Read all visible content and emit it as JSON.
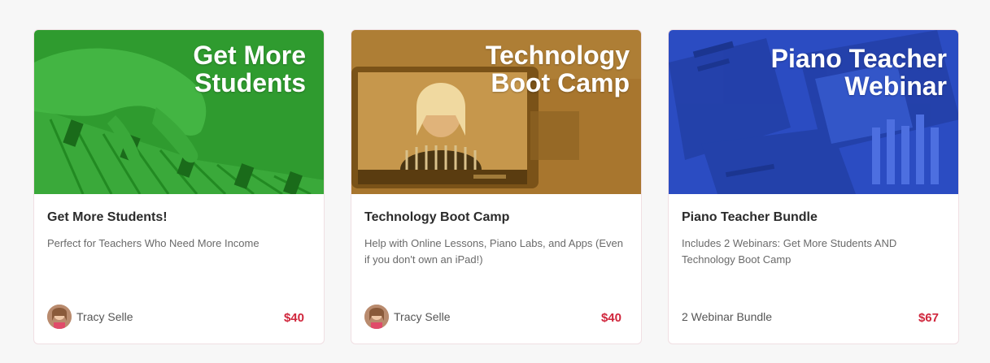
{
  "colors": {
    "green_banner": "#2f9b2f",
    "gold_banner": "#a8762e",
    "blue_banner": "#2b4cc2",
    "price": "#d0263c"
  },
  "cards": [
    {
      "banner_text": "Get More\nStudents",
      "title": "Get More Students!",
      "description": "Perfect for Teachers Who Need More Income",
      "author": "Tracy Selle",
      "price": "$40"
    },
    {
      "banner_text": "Technology\nBoot Camp",
      "title": "Technology Boot Camp",
      "description": "Help with Online Lessons, Piano Labs, and Apps (Even if you don't own an iPad!)",
      "author": "Tracy Selle",
      "price": "$40"
    },
    {
      "banner_text": "Piano Teacher\nWebinar",
      "title": "Piano Teacher Bundle",
      "description": "Includes 2 Webinars: Get More Students AND Technology Boot Camp",
      "bundle_label": "2 Webinar Bundle",
      "price": "$67"
    }
  ]
}
